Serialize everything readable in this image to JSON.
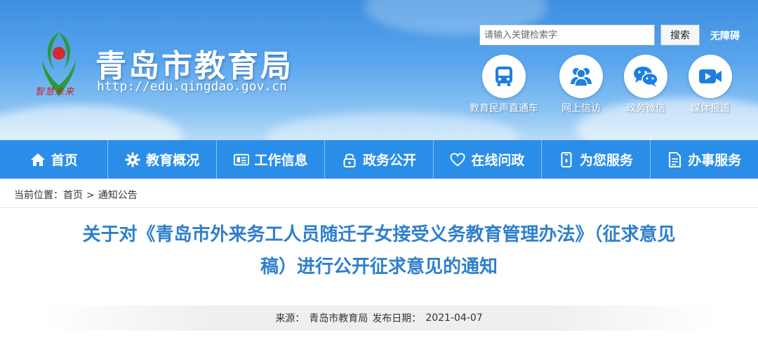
{
  "header": {
    "title": "青岛市教育局",
    "url": "http://edu.qingdao.gov.cn",
    "logo_text": "智慧未来",
    "search": {
      "placeholder": "请输入关键检索字",
      "button_label": "搜索"
    },
    "accessibility_label": "无障碍",
    "quick_links": [
      {
        "label": "教育民声直通车",
        "icon": "bus-icon"
      },
      {
        "label": "网上信访",
        "icon": "users-icon"
      },
      {
        "label": "政务微信",
        "icon": "wechat-icon"
      },
      {
        "label": "媒体报道",
        "icon": "video-icon"
      }
    ]
  },
  "nav": {
    "items": [
      {
        "label": "首页",
        "icon": "home-icon"
      },
      {
        "label": "教育概况",
        "icon": "gear-icon"
      },
      {
        "label": "工作信息",
        "icon": "news-icon"
      },
      {
        "label": "政务公开",
        "icon": "lock-icon"
      },
      {
        "label": "在线问政",
        "icon": "heart-icon"
      },
      {
        "label": "为您服务",
        "icon": "phone-icon"
      },
      {
        "label": "办事服务",
        "icon": "document-icon"
      }
    ]
  },
  "breadcrumb": {
    "prefix": "当前位置：",
    "items": [
      "首页",
      "通知公告"
    ],
    "separator": ">"
  },
  "article": {
    "title_line1": "关于对《青岛市外来务工人员随迁子女接受义务教育管理办法》（征求意见",
    "title_line2": "稿）进行公开征求意见的通知",
    "source_label": "来源：",
    "source": "青岛市教育局",
    "date_label": "发布日期：",
    "date": "2021-04-07"
  },
  "colors": {
    "nav_bg": "#2a8ee8",
    "title_blue": "#2f7fcb",
    "header_top": "#3d8fe0",
    "icon_blue": "#1f7fe0",
    "logo_red": "#d42a2a",
    "logo_green": "#2a9a3a"
  }
}
